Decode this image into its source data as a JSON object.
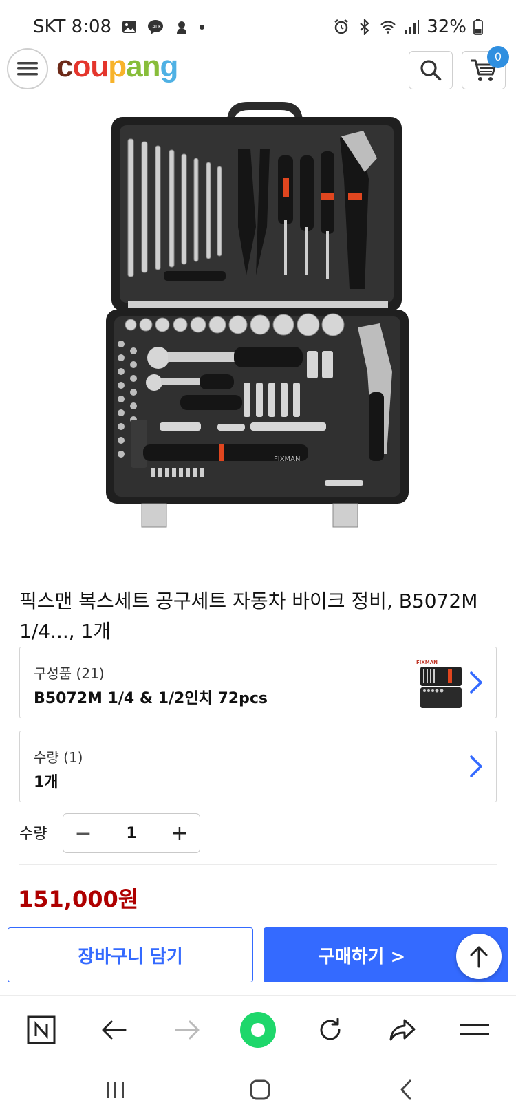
{
  "status_bar": {
    "carrier_time": "SKT 8:08",
    "battery": "32%"
  },
  "header": {
    "logo_letters": [
      {
        "ch": "c",
        "color": "#6d2a19"
      },
      {
        "ch": "o",
        "color": "#e4352c"
      },
      {
        "ch": "u",
        "color": "#e4352c"
      },
      {
        "ch": "p",
        "color": "#f7b32b"
      },
      {
        "ch": "a",
        "color": "#88bd3a"
      },
      {
        "ch": "n",
        "color": "#88bd3a"
      },
      {
        "ch": "g",
        "color": "#4fb1e4"
      }
    ],
    "cart_count": "0"
  },
  "product": {
    "title": "픽스맨 복스세트 공구세트 자동차 바이크 정비, B5072M 1/4..., 1개",
    "image_brand": "FIXMAN"
  },
  "options": [
    {
      "label": "구성품 (21)",
      "value": "B5072M 1/4 & 1/2인치 72pcs",
      "has_thumbnail": true
    },
    {
      "label": "수량 (1)",
      "value": "1개",
      "has_thumbnail": false
    }
  ],
  "quantity": {
    "label": "수량",
    "value": "1",
    "minus": "−",
    "plus": "+"
  },
  "price": "151,000원",
  "actions": {
    "add_to_cart": "장바구니 담기",
    "buy_now": "구매하기 >"
  },
  "icons": {
    "menu": "hamburger-icon",
    "search": "search-icon",
    "cart": "cart-icon",
    "scroll_top": "arrow-up-icon",
    "chevron": "chevron-right-icon"
  },
  "colors": {
    "accent_blue": "#346aff",
    "price_red": "#ae0000",
    "badge_blue": "#2f8fe0",
    "green_home": "#1ed76b"
  }
}
